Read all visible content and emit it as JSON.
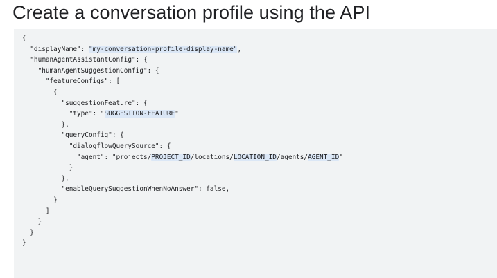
{
  "title": "Create a conversation profile using the API",
  "code_lines": [
    [
      {
        "t": "{"
      }
    ],
    [
      {
        "t": "  \"displayName\": "
      },
      {
        "t": "\"my-conversation-profile-display-name\"",
        "hl": true
      },
      {
        "t": ","
      }
    ],
    [
      {
        "t": "  \"humanAgentAssistantConfig\": {"
      }
    ],
    [
      {
        "t": "    \"humanAgentSuggestionConfig\": {"
      }
    ],
    [
      {
        "t": "      \"featureConfigs\": ["
      }
    ],
    [
      {
        "t": "        {"
      }
    ],
    [
      {
        "t": "          \"suggestionFeature\": {"
      }
    ],
    [
      {
        "t": "            \"type\": \""
      },
      {
        "t": "SUGGESTION-FEATURE",
        "hl": true
      },
      {
        "t": "\""
      }
    ],
    [
      {
        "t": "          },"
      }
    ],
    [
      {
        "t": "          \"queryConfig\": {"
      }
    ],
    [
      {
        "t": "            \"dialogflowQuerySource\": {"
      }
    ],
    [
      {
        "t": "              \"agent\": \"projects/"
      },
      {
        "t": "PROJECT_ID",
        "hl": true
      },
      {
        "t": "/locations/"
      },
      {
        "t": "LOCATION_ID",
        "hl": true
      },
      {
        "t": "/agents/"
      },
      {
        "t": "AGENT_ID",
        "hl": true
      },
      {
        "t": "\""
      }
    ],
    [
      {
        "t": "            }"
      }
    ],
    [
      {
        "t": "          },"
      }
    ],
    [
      {
        "t": "          \"enableQuerySuggestionWhenNoAnswer\": false,"
      }
    ],
    [
      {
        "t": "        }"
      }
    ],
    [
      {
        "t": "      ]"
      }
    ],
    [
      {
        "t": "    }"
      }
    ],
    [
      {
        "t": "  }"
      }
    ],
    [
      {
        "t": "}"
      }
    ]
  ]
}
